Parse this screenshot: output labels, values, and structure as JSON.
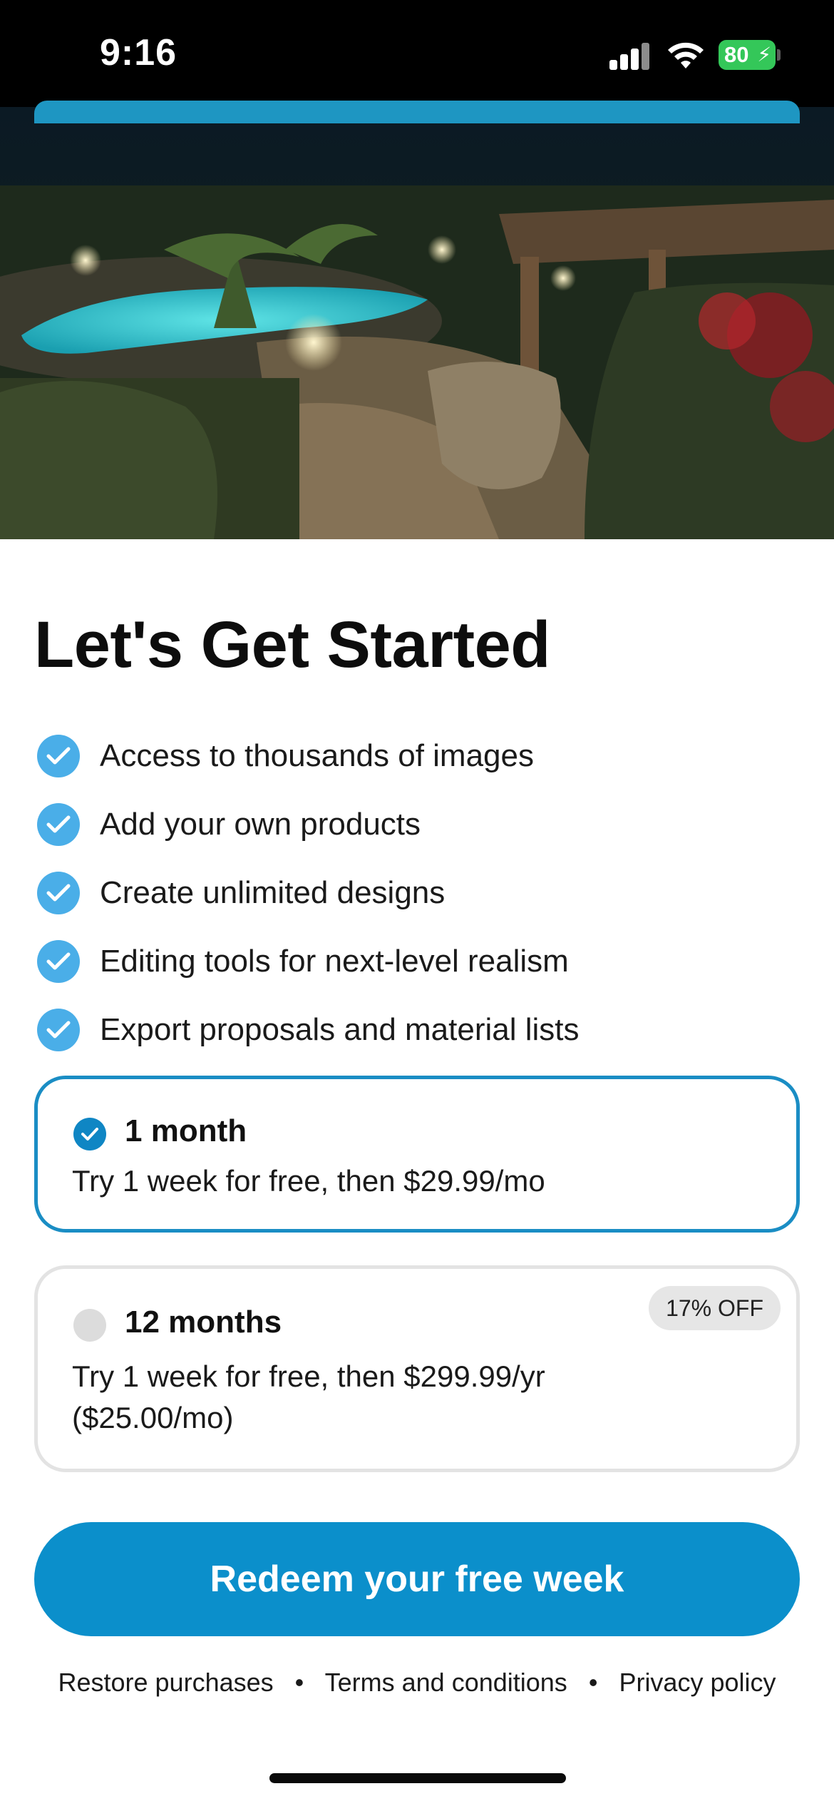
{
  "status_bar": {
    "time": "9:16",
    "battery_level": "80",
    "icons": [
      "signal-icon",
      "wifi-icon",
      "battery-icon"
    ]
  },
  "hero": {
    "image": "night-garden-pool-photo"
  },
  "title": "Let's Get Started",
  "features": [
    "Access to thousands of images",
    "Add your own products",
    "Create unlimited designs",
    "Editing tools for next-level realism",
    "Export proposals and material lists"
  ],
  "plans": {
    "monthly": {
      "name": "1 month",
      "description": "Try 1 week for free, then $29.99/mo",
      "selected": true
    },
    "yearly": {
      "name": "12 months",
      "description_line1": "Try 1 week for free, then $299.99/yr",
      "description_line2": "($25.00/mo)",
      "badge": "17% OFF",
      "selected": false
    }
  },
  "cta_label": "Redeem your free week",
  "footer": {
    "restore": "Restore purchases",
    "separator": "•",
    "terms": "Terms and conditions",
    "privacy": "Privacy policy"
  },
  "colors": {
    "accent": "#0b8fcb",
    "check": "#4aaee8",
    "battery": "#34c759"
  }
}
